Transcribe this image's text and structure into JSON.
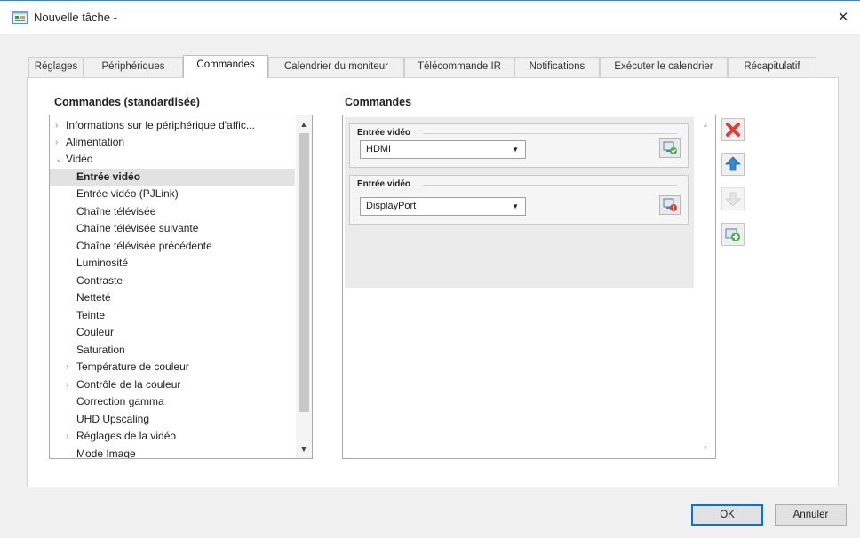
{
  "window": {
    "title": "Nouvelle tâche -",
    "close_glyph": "✕"
  },
  "tabs": [
    {
      "label": "Réglages"
    },
    {
      "label": "Périphériques"
    },
    {
      "label": "Commandes",
      "active": true
    },
    {
      "label": "Calendrier du moniteur"
    },
    {
      "label": "Télécommande IR"
    },
    {
      "label": "Notifications"
    },
    {
      "label": "Exécuter le calendrier"
    },
    {
      "label": "Récapitulatif"
    }
  ],
  "left": {
    "heading": "Commandes (standardisée)",
    "tree": [
      {
        "label": "Informations sur le périphérique d'affic...",
        "expander": "›"
      },
      {
        "label": "Alimentation",
        "expander": "›"
      },
      {
        "label": "Vidéo",
        "expander": "⌄"
      },
      {
        "label": "Entrée vidéo",
        "selected": true
      },
      {
        "label": "Entrée vidéo (PJLink)"
      },
      {
        "label": "Chaîne télévisée"
      },
      {
        "label": "Chaîne télévisée suivante"
      },
      {
        "label": "Chaîne télévisée précédente"
      },
      {
        "label": "Luminosité"
      },
      {
        "label": "Contraste"
      },
      {
        "label": "Netteté"
      },
      {
        "label": "Teinte"
      },
      {
        "label": "Couleur"
      },
      {
        "label": "Saturation"
      },
      {
        "label": "Température de couleur",
        "expander": "›"
      },
      {
        "label": "Contrôle de la couleur",
        "expander": "›"
      },
      {
        "label": "Correction gamma"
      },
      {
        "label": "UHD Upscaling"
      },
      {
        "label": "Réglages de la vidéo",
        "expander": "›"
      },
      {
        "label": "Mode Image"
      }
    ]
  },
  "right": {
    "heading": "Commandes",
    "commands": [
      {
        "legend": "Entrée vidéo",
        "value": "HDMI",
        "status": "ok"
      },
      {
        "legend": "Entrée vidéo",
        "value": "DisplayPort",
        "status": "error"
      }
    ]
  },
  "side_buttons": [
    {
      "name": "delete-icon",
      "color": "#e53935"
    },
    {
      "name": "move-up-icon",
      "color": "#2e8bd6"
    },
    {
      "name": "move-down-icon",
      "color": "#cfcfcf",
      "disabled": true
    },
    {
      "name": "add-command-icon",
      "color": "#4caf50"
    }
  ],
  "footer": {
    "ok_label": "OK",
    "cancel_label": "Annuler"
  },
  "colors": {
    "accent": "#0078d7",
    "selection": "#e2e2e2"
  }
}
